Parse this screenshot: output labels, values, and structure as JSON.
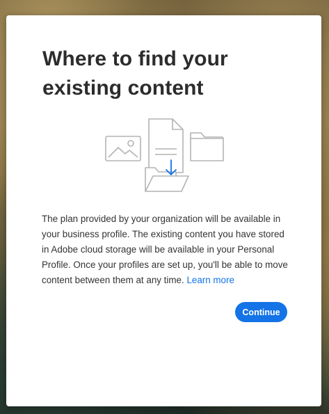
{
  "dialog": {
    "title": "Where to find your existing content",
    "illustration_icons": [
      "image-icon",
      "document-icon",
      "folder-icon",
      "download-arrow-icon",
      "open-folder-icon"
    ],
    "body_text": "The plan provided by your organization will be available in your business profile. The existing content you have stored in Adobe cloud storage will be available in your Personal Profile. Once your profiles are set up, you'll be able to move content between them at any time.",
    "learn_more_label": "Learn more",
    "continue_label": "Continue"
  },
  "colors": {
    "accent": "#1473e6",
    "title_text": "#2c2c2c",
    "body_text": "#333333",
    "icon_stroke": "#b3b3b3"
  }
}
